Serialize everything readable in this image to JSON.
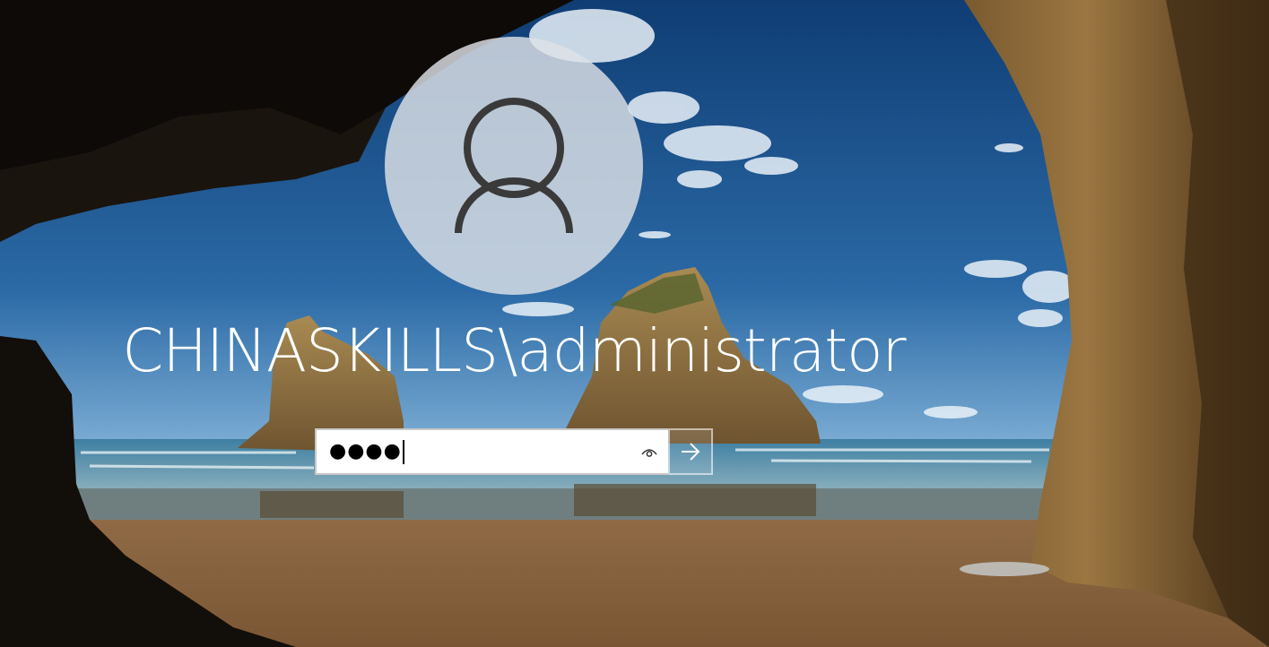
{
  "user": {
    "display_name": "CHINASKILLS\\administrator",
    "avatar_icon": "user-silhouette-icon"
  },
  "password": {
    "masked_value": "●●●●",
    "reveal_icon": "eye-icon",
    "submit_icon": "arrow-right-icon"
  },
  "colors": {
    "avatar_bg": "#dee2e6",
    "avatar_glyph": "#3a3a3a",
    "text": "#ffffff",
    "input_bg": "#ffffff"
  }
}
